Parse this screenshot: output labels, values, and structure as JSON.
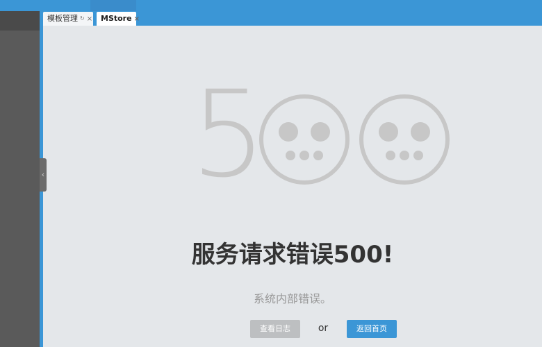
{
  "tabs": [
    {
      "label": "模板管理",
      "reload_icon": "reload-icon",
      "close_icon": "close-icon"
    },
    {
      "label": "MStore",
      "close_icon": "close-icon"
    }
  ],
  "error": {
    "big_code_digit": "5",
    "face_icon": "sad-face-icon",
    "heading": "服务请求错误500!",
    "message": "系统内部错误。"
  },
  "actions": {
    "view_log_label": "查看日志",
    "or_label": "or",
    "home_label": "返回首页"
  },
  "colors": {
    "brand_blue": "#3b96d6",
    "sidebar": "#5a5a5a",
    "background": "#e4e7ea",
    "watermark": "#c7c7c7",
    "button_gray": "#bdbfc1"
  }
}
